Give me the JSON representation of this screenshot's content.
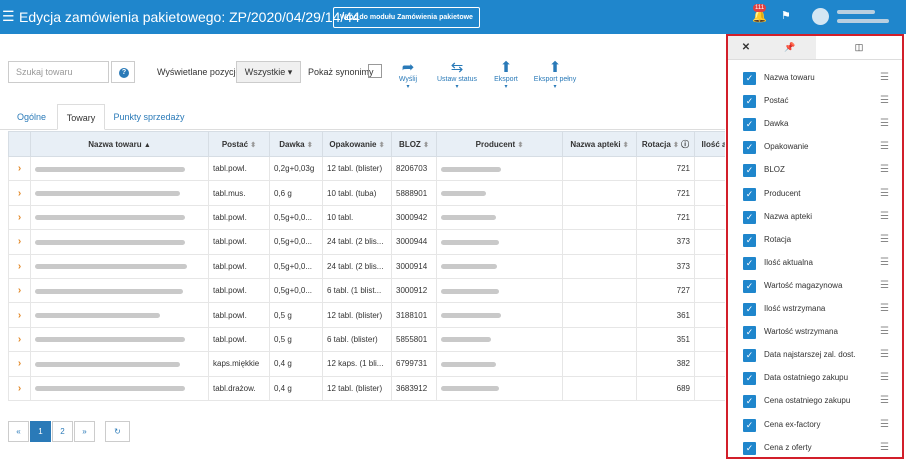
{
  "header": {
    "title": "Edycja zamówienia pakietowego: ZP/2020/04/29/14/44",
    "back_button": "Wróć do modułu Zamówienia pakietowe",
    "notification_count": "111"
  },
  "toolbar": {
    "search_placeholder": "Szukaj towaru",
    "positions_label": "Wyświetlane pozycje",
    "positions_value": "Wszystkie",
    "synonyms_label": "Pokaż synonimy",
    "actions": [
      {
        "label": "Wyślij",
        "icon": "share-icon"
      },
      {
        "label": "Ustaw status",
        "icon": "swap-icon"
      },
      {
        "label": "Eksport",
        "icon": "upload-icon"
      },
      {
        "label": "Eksport pełny",
        "icon": "upload-icon"
      }
    ]
  },
  "tabs": [
    "Ogólne",
    "Towary",
    "Punkty sprzedaży"
  ],
  "table": {
    "columns": [
      "Nazwa towaru",
      "Postać",
      "Dawka",
      "Opakowanie",
      "BLOZ",
      "Producent",
      "Nazwa apteki",
      "Rotacja",
      "Ilość a"
    ],
    "rows": [
      {
        "postac": "tabl.powl.",
        "dawka": "0,2g+0,03g",
        "opak": "12 tabl. (blister)",
        "bloz": "8206703",
        "rotacja": "721"
      },
      {
        "postac": "tabl.mus.",
        "dawka": "0,6 g",
        "opak": "10 tabl. (tuba)",
        "bloz": "5888901",
        "rotacja": "721"
      },
      {
        "postac": "tabl.powl.",
        "dawka": "0,5g+0,0...",
        "opak": "10 tabl.",
        "bloz": "3000942",
        "rotacja": "721"
      },
      {
        "postac": "tabl.powl.",
        "dawka": "0,5g+0,0...",
        "opak": "24 tabl. (2 blis...",
        "bloz": "3000944",
        "rotacja": "373"
      },
      {
        "postac": "tabl.powl.",
        "dawka": "0,5g+0,0...",
        "opak": "24 tabl. (2 blis...",
        "bloz": "3000914",
        "rotacja": "373"
      },
      {
        "postac": "tabl.powl.",
        "dawka": "0,5g+0,0...",
        "opak": "6 tabl. (1 blist...",
        "bloz": "3000912",
        "rotacja": "727"
      },
      {
        "postac": "tabl.powl.",
        "dawka": "0,5 g",
        "opak": "12 tabl. (blister)",
        "bloz": "3188101",
        "rotacja": "361"
      },
      {
        "postac": "tabl.powl.",
        "dawka": "0,5 g",
        "opak": "6 tabl. (blister)",
        "bloz": "5855801",
        "rotacja": "351"
      },
      {
        "postac": "kaps.miękkie",
        "dawka": "0,4 g",
        "opak": "12 kaps. (1 bli...",
        "bloz": "6799731",
        "rotacja": "382"
      },
      {
        "postac": "tabl.drażow.",
        "dawka": "0,4 g",
        "opak": "12 tabl. (blister)",
        "bloz": "3683912",
        "rotacja": "689"
      }
    ]
  },
  "pager": {
    "prev": "«",
    "pages": [
      "1",
      "2"
    ],
    "next": "»"
  },
  "column_panel": {
    "items": [
      "Nazwa towaru",
      "Postać",
      "Dawka",
      "Opakowanie",
      "BLOZ",
      "Producent",
      "Nazwa apteki",
      "Rotacja",
      "Ilość aktualna",
      "Wartość magazynowa",
      "Ilość wstrzymana",
      "Wartość wstrzymana",
      "Data najstarszej zal. dost.",
      "Data ostatniego zakupu",
      "Cena ostatniego zakupu",
      "Cena ex-factory",
      "Cena z oferty"
    ]
  },
  "colors": {
    "header_bg": "#1f86cc",
    "accent": "#2a7ab8",
    "highlight_border": "#d21f2a",
    "expand_arrow": "#e38b2c"
  }
}
